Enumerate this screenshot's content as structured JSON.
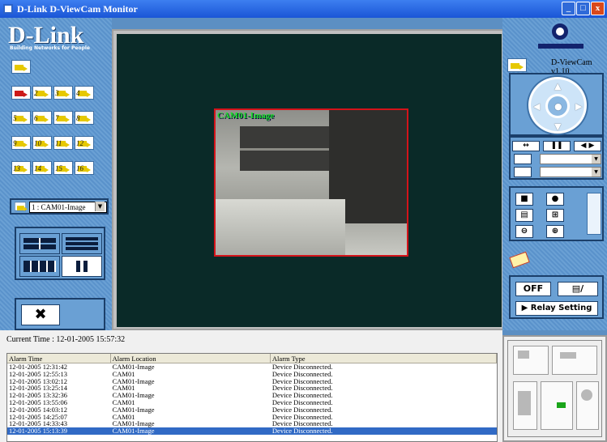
{
  "window": {
    "title": "D-Link D-ViewCam Monitor",
    "min": "_",
    "max": "□",
    "close": "x"
  },
  "brand": {
    "name": "D-Link",
    "tagline": "Building Networks for People"
  },
  "left": {
    "camera_buttons": [
      "",
      "2",
      "3",
      "4",
      "5",
      "6",
      "7",
      "8",
      "9",
      "10",
      "11",
      "12",
      "13",
      "14",
      "15",
      "16"
    ],
    "camera_select": "1 : CAM01-Image"
  },
  "video": {
    "caption": "CAM01-Image"
  },
  "right": {
    "version": "D-ViewCam v1.10",
    "ptz_arrows": {
      "up": "▲",
      "down": "▼",
      "left": "◀",
      "right": "▶",
      "center": "●"
    },
    "pan_buttons": [
      "↔",
      "❚❚",
      "◀ ▶"
    ],
    "action_icons": [
      "■",
      "●",
      "▤",
      "⊞",
      "⊖",
      "⊕"
    ],
    "relay": {
      "off": "OFF",
      "toggle": "▤/",
      "setting": "▶ Relay Setting"
    }
  },
  "status": {
    "current_time": "Current Time : 12-01-2005 15:57:32"
  },
  "alarm_table": {
    "headers": [
      "Alarm Time",
      "Alarm Location",
      "Alarm Type"
    ],
    "rows": [
      [
        "12-01-2005 12:31:42",
        "CAM01-Image",
        "Device Disconnected."
      ],
      [
        "12-01-2005 12:55:13",
        "CAM01",
        "Device Disconnected."
      ],
      [
        "12-01-2005 13:02:12",
        "CAM01-Image",
        "Device Disconnected."
      ],
      [
        "12-01-2005 13:25:14",
        "CAM01",
        "Device Disconnected."
      ],
      [
        "12-01-2005 13:32:36",
        "CAM01-Image",
        "Device Disconnected."
      ],
      [
        "12-01-2005 13:55:06",
        "CAM01",
        "Device Disconnected."
      ],
      [
        "12-01-2005 14:03:12",
        "CAM01-Image",
        "Device Disconnected."
      ],
      [
        "12-01-2005 14:25:07",
        "CAM01",
        "Device Disconnected."
      ],
      [
        "12-01-2005 14:33:43",
        "CAM01-Image",
        "Device Disconnected."
      ],
      [
        "12-01-2005 15:13:39",
        "CAM01-Image",
        "Device Disconnected."
      ]
    ],
    "selected_row": 9
  },
  "colors": {
    "panel": "#5a92cb",
    "video_bg": "#0a2a28",
    "feed_border": "#d4131a",
    "caption": "#16e028",
    "selected": "#316ac5"
  }
}
